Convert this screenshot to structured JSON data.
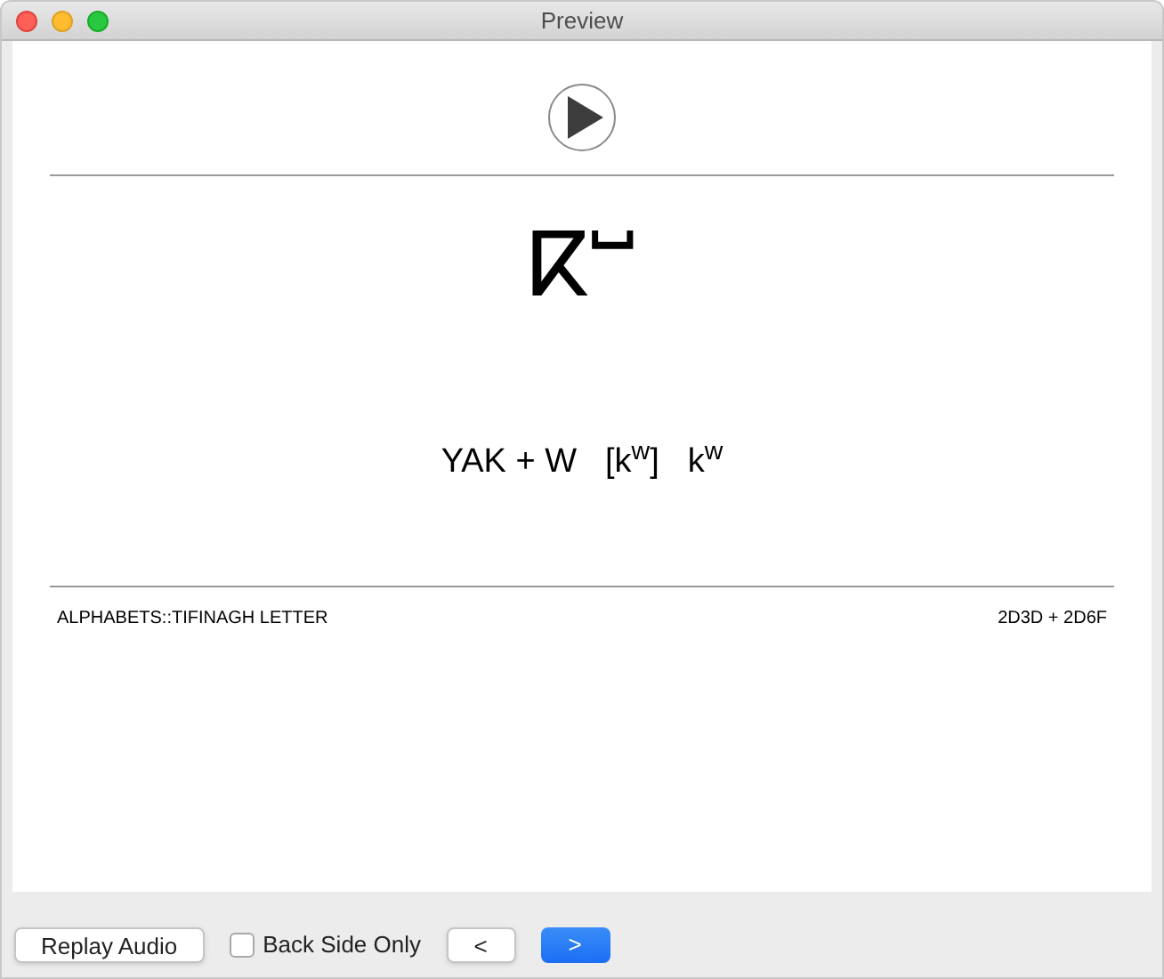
{
  "window": {
    "title": "Preview"
  },
  "card": {
    "glyph": "ⴽⵯ",
    "parts": [
      "YAK + W",
      "[k$^{w}$]",
      "k$^{w}$"
    ],
    "deck": "ALPHABETS::TIFINAGH LETTER",
    "codepoints": "2D3D + 2D6F"
  },
  "footer": {
    "replay": "Replay Audio",
    "back_side_only": {
      "label": "Back Side Only",
      "checked": false
    },
    "prev": "<",
    "next": ">"
  }
}
